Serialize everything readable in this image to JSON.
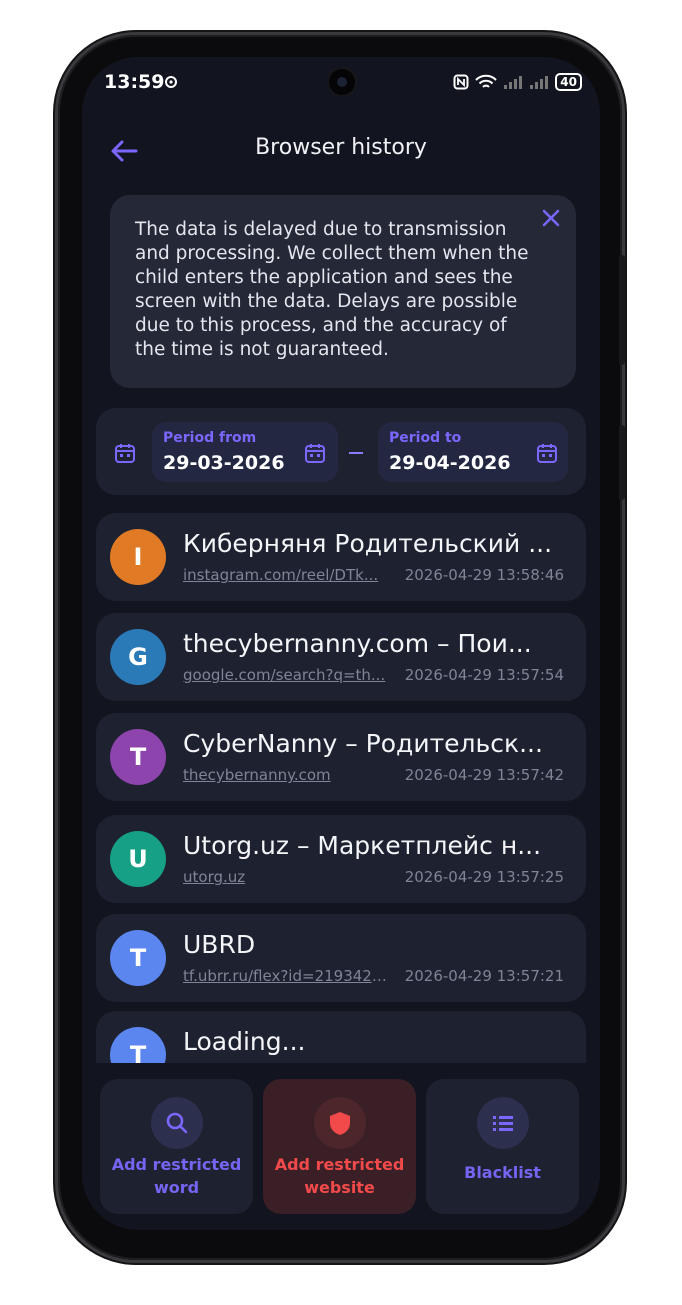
{
  "status": {
    "time": "13:59",
    "battery": "40"
  },
  "header": {
    "title": "Browser history"
  },
  "notice": {
    "text": "The data is delayed due to transmission and processing. We collect them when the child enters the application and sees the screen with the data. Delays are possible due to this process, and the accuracy of the time is not guaranteed."
  },
  "period": {
    "from_label": "Period from",
    "from_value": "29-03-2026",
    "to_label": "Period to",
    "to_value": "29-04-2026"
  },
  "history": [
    {
      "letter": "I",
      "color": "#e07a25",
      "title": "Киберняня Родительский ...",
      "url": "instagram.com/reel/DTk...",
      "time": "2026-04-29 13:58:46"
    },
    {
      "letter": "G",
      "color": "#2b7ab8",
      "title": "thecybernanny.com – Пои...",
      "url": "google.com/search?q=th...",
      "time": "2026-04-29 13:57:54"
    },
    {
      "letter": "T",
      "color": "#8e44ad",
      "title": "CyberNanny – Родительск...",
      "url": "thecybernanny.com",
      "time": "2026-04-29 13:57:42"
    },
    {
      "letter": "U",
      "color": "#16a085",
      "title": "Utorg.uz – Маркетплейс н...",
      "url": "utorg.uz",
      "time": "2026-04-29 13:57:25"
    },
    {
      "letter": "T",
      "color": "#5b86f0",
      "title": "UBRD",
      "url": "tf.ubrr.ru/flex?id=21934224...",
      "time": "2026-04-29 13:57:21"
    },
    {
      "letter": "T",
      "color": "#5b86f0",
      "title": "Loading...",
      "url": "",
      "time": ""
    }
  ],
  "actions": {
    "restricted_word": "Add restricted word",
    "restricted_website": "Add restricted website",
    "blacklist": "Blacklist"
  },
  "colors": {
    "accent": "#7a67ff",
    "danger": "#f24a4a",
    "background": "#121520",
    "card": "#1d2130"
  }
}
